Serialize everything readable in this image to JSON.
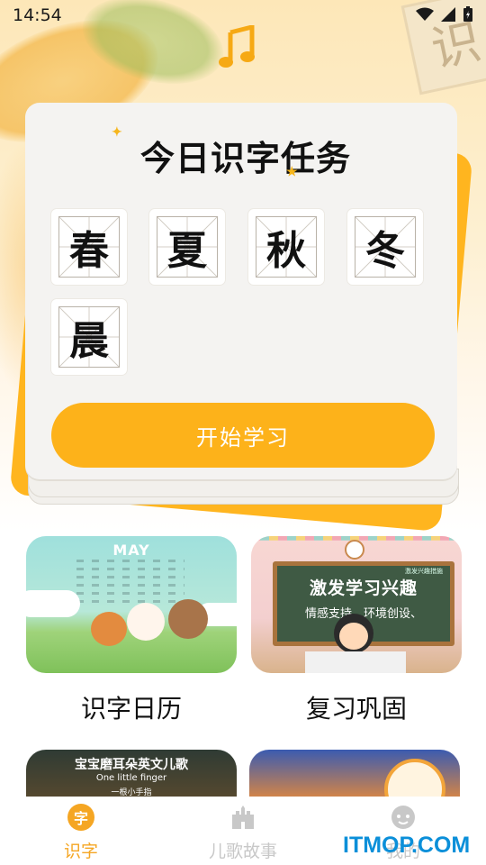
{
  "status_bar": {
    "time": "14:54"
  },
  "decor": {
    "background_char": "识"
  },
  "task_card": {
    "title": "今日识字任务",
    "characters": [
      "春",
      "夏",
      "秋",
      "冬",
      "晨"
    ],
    "start_button": "开始学习"
  },
  "features": [
    {
      "label": "识字日历",
      "thumb_month": "MAY"
    },
    {
      "label": "复习巩固",
      "board_line1": "激发学习兴趣",
      "board_line2": "情感支持、环境创设、",
      "board_small": "激发兴趣措施"
    }
  ],
  "peek_cards": [
    {
      "title": "宝宝磨耳朵英文儿歌",
      "subtitle": "One little finger",
      "caption": "一根小手指"
    },
    {}
  ],
  "bottom_nav": {
    "items": [
      {
        "label": "识字",
        "icon": "zi-icon",
        "glyph": "字",
        "active": true
      },
      {
        "label": "儿歌故事",
        "icon": "castle-icon",
        "active": false
      },
      {
        "label": "我的",
        "icon": "baby-face-icon",
        "active": false
      }
    ]
  },
  "watermark": "ITMOP.COM",
  "colors": {
    "accent": "#fdb21a",
    "card_back": "#ffb51f",
    "card_face": "#f4f3f1",
    "active_nav": "#f5a623",
    "inactive_nav": "#c8c8c8",
    "watermark": "#0b8fd9"
  }
}
